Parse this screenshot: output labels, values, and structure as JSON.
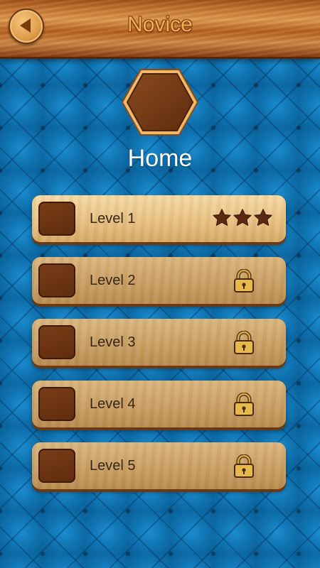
{
  "header": {
    "title": "Novice"
  },
  "pack": {
    "name": "Home"
  },
  "levels": [
    {
      "label": "Level 1",
      "status": "completed",
      "stars": 3
    },
    {
      "label": "Level 2",
      "status": "locked"
    },
    {
      "label": "Level 3",
      "status": "locked"
    },
    {
      "label": "Level 4",
      "status": "locked"
    },
    {
      "label": "Level 5",
      "status": "locked"
    }
  ],
  "colors": {
    "background": "#0c6aa6",
    "wood_light": "#e9c68f",
    "wood_dark": "#6b3a12",
    "title": "#f3b052",
    "star": "#5a2b10",
    "lock_gold": "#e7b84a"
  }
}
